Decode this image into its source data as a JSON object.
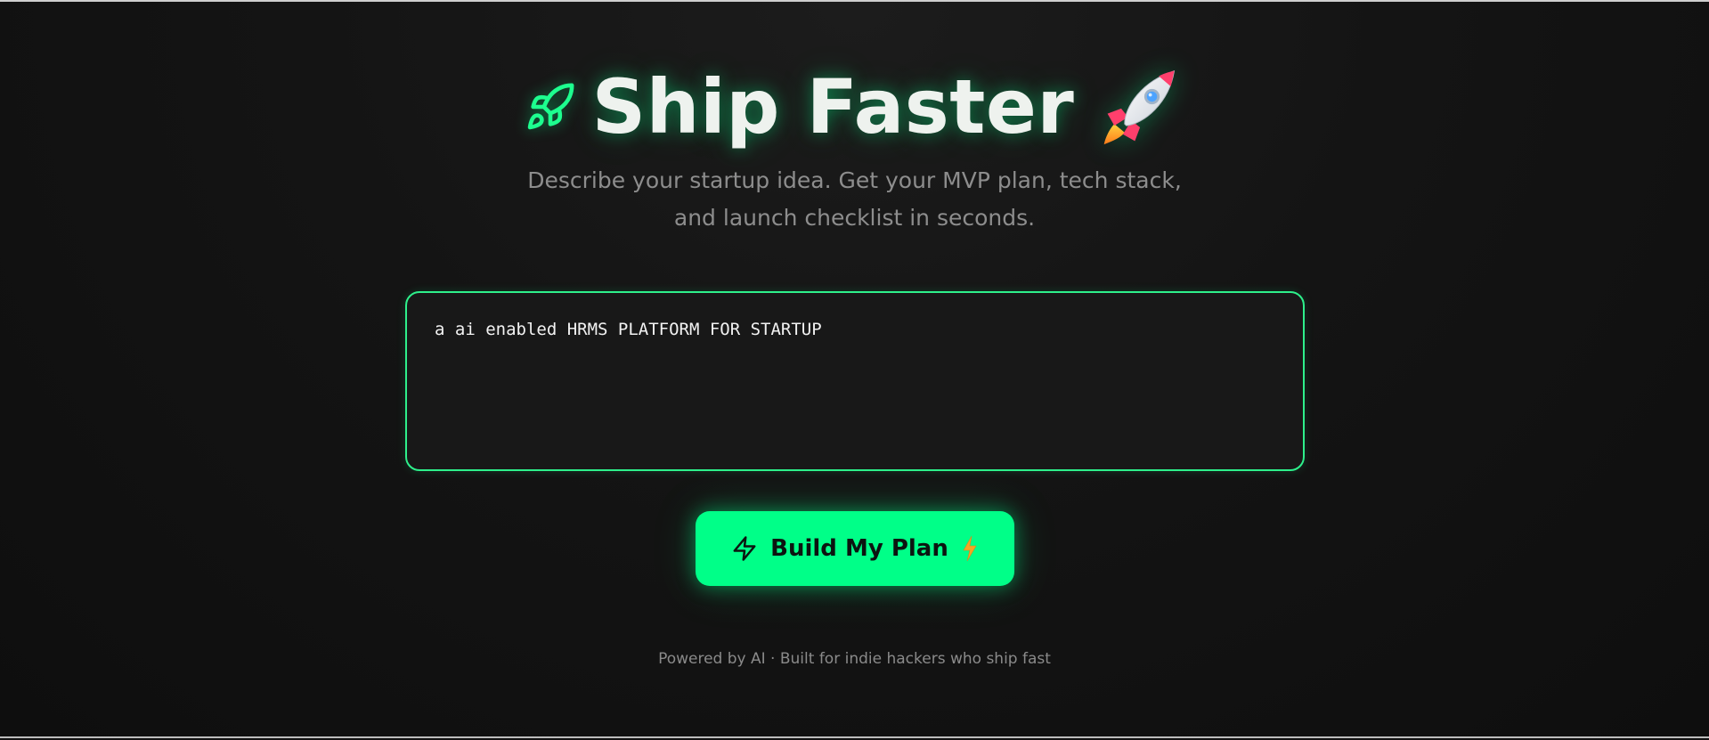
{
  "hero": {
    "title": "Ship Faster",
    "leaf_icon": "rocket-outline-icon",
    "title_emoji": "rocket-emoji"
  },
  "subtitle": {
    "line1": "Describe your startup idea. Get your MVP plan, tech stack,",
    "line2": "and launch checklist in seconds."
  },
  "idea_input": {
    "value": "a ai enabled HRMS PLATFORM FOR STARTUP",
    "placeholder": ""
  },
  "build_button": {
    "label": "Build My Plan",
    "icon": "lightning-bolt-icon",
    "trailing_emoji": "high-voltage-emoji"
  },
  "footer": {
    "text": "Powered by AI · Built for indie hackers who ship fast"
  },
  "colors": {
    "accent": "#00ff88",
    "background": "#111111",
    "title_text": "#eef2ee",
    "muted_text": "#8d8d8d",
    "input_bg": "#181818"
  }
}
